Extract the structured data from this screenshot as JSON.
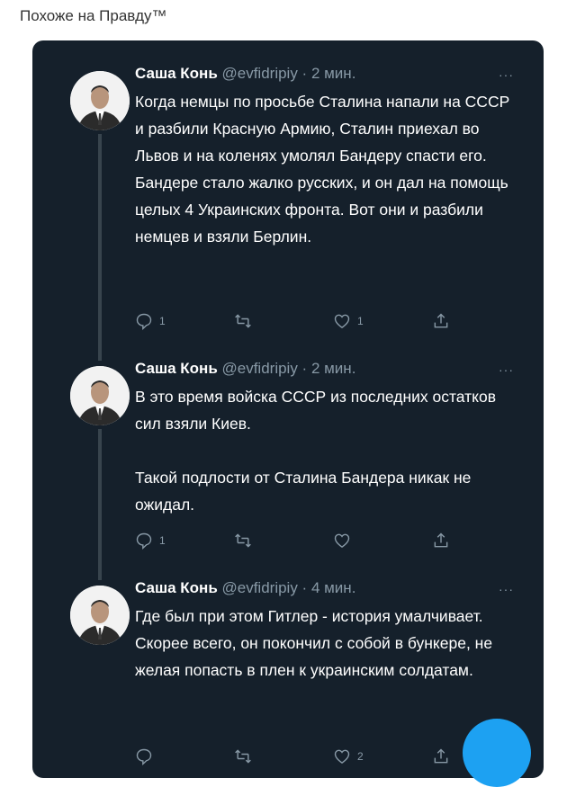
{
  "caption": "Похоже на Правду™",
  "tweets": [
    {
      "name": "Саша Конь",
      "meta": "@evfidripiy · 2 мин.",
      "more": "···",
      "text": "Когда немцы по просьбе Сталина напали на СССР и разбили Красную Армию, Сталин приехал во Львов и на коленях умолял Бандеру спасти его. Бандере стало жалко русских, и он дал на помощь целых 4 Украинских фронта. Вот они и разбили немцев и взяли Берлин.",
      "replies": "1",
      "retweets": "",
      "likes": "1"
    },
    {
      "name": "Саша Конь",
      "meta": "@evfidripiy · 2 мин.",
      "more": "···",
      "text": "В это время войска СССР из последних остатков сил взяли Киев.",
      "text2": "Такой подлости от Сталина Бандера никак не ожидал.",
      "replies": "1",
      "retweets": "",
      "likes": ""
    },
    {
      "name": "Саша Конь",
      "meta": "@evfidripiy · 4 мин.",
      "more": "···",
      "text": "Где был при этом Гитлер - история умалчивает. Скорее всего, он покончил с собой в бункере, не желая попасть в плен к украинским солдатам.",
      "replies": "",
      "retweets": "",
      "likes": "2"
    }
  ],
  "icons": {
    "reply": "reply-icon",
    "retweet": "retweet-icon",
    "like": "heart-icon",
    "share": "share-icon",
    "compose": "compose-fab"
  },
  "colors": {
    "panel": "#15202b",
    "muted": "#8899a6",
    "accent": "#1da1f2",
    "thread": "#38444d"
  }
}
